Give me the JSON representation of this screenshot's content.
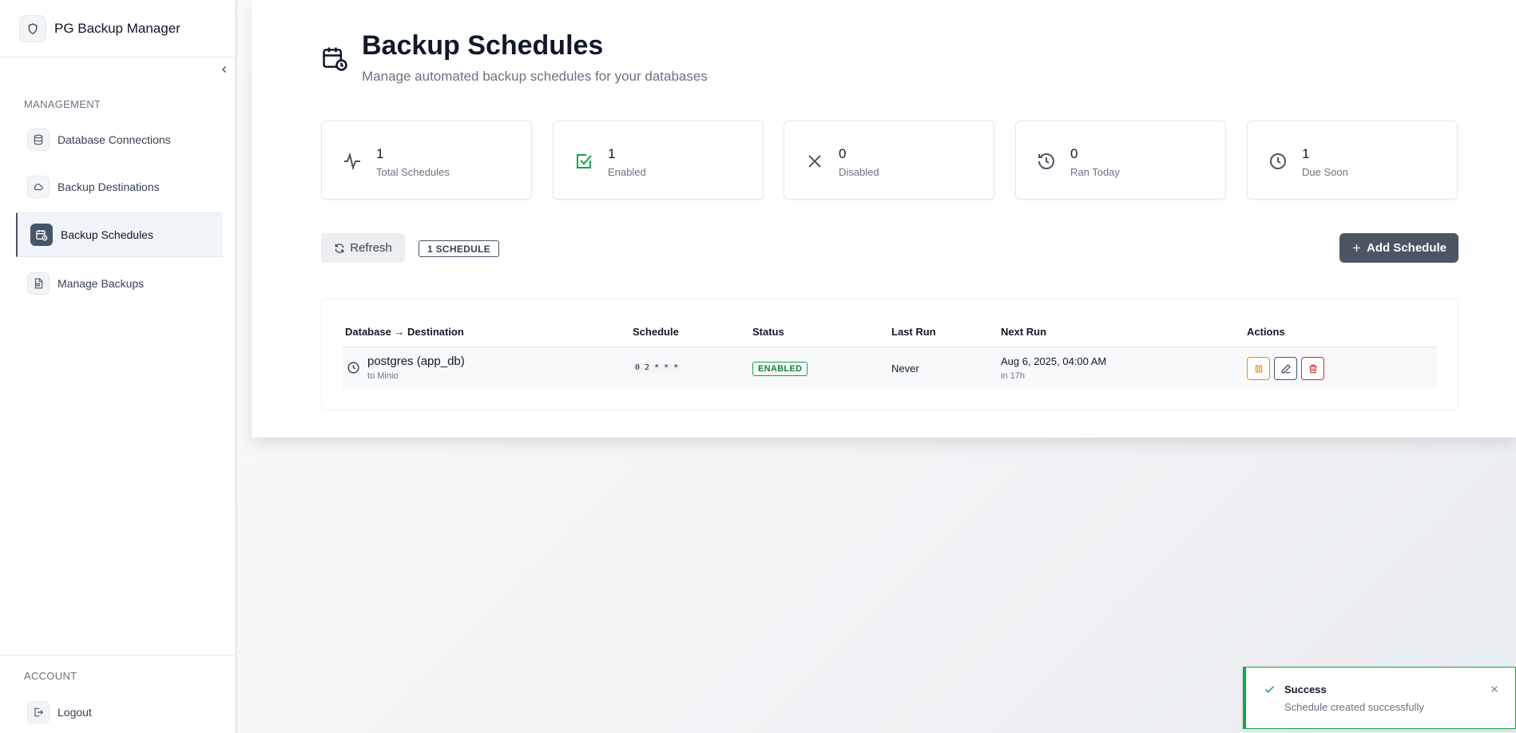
{
  "app": {
    "title": "PG Backup Manager"
  },
  "sidebar": {
    "management_label": "MANAGEMENT",
    "account_label": "ACCOUNT",
    "items": [
      {
        "label": "Database Connections",
        "icon": "database-icon"
      },
      {
        "label": "Backup Destinations",
        "icon": "cloud-icon"
      },
      {
        "label": "Backup Schedules",
        "icon": "calendar-clock-icon",
        "active": true
      },
      {
        "label": "Manage Backups",
        "icon": "file-archive-icon"
      }
    ],
    "logout_label": "Logout"
  },
  "page": {
    "title": "Backup Schedules",
    "subtitle": "Manage automated backup schedules for your databases"
  },
  "stats": [
    {
      "value": "1",
      "label": "Total Schedules",
      "icon": "activity-icon"
    },
    {
      "value": "1",
      "label": "Enabled",
      "icon": "check-square-icon",
      "color": "#16a34a"
    },
    {
      "value": "0",
      "label": "Disabled",
      "icon": "x-icon"
    },
    {
      "value": "0",
      "label": "Ran Today",
      "icon": "history-icon"
    },
    {
      "value": "1",
      "label": "Due Soon",
      "icon": "clock-icon"
    }
  ],
  "toolbar": {
    "refresh_label": "Refresh",
    "count_badge": "1 SCHEDULE",
    "add_label": "Add Schedule"
  },
  "table": {
    "headers": [
      "Database → Destination",
      "Schedule",
      "Status",
      "Last Run",
      "Next Run",
      "Actions"
    ],
    "rows": [
      {
        "database": "postgres (app_db)",
        "destination": "to Minio",
        "schedule": "0 2 * * *",
        "status": "ENABLED",
        "last_run": "Never",
        "next_run": "Aug 6, 2025, 04:00 AM",
        "next_run_relative": "in 17h"
      }
    ]
  },
  "toast": {
    "title": "Success",
    "message": "Schedule created successfully"
  },
  "colors": {
    "accent": "#4b5563",
    "success": "#16a34a",
    "pause": "#ea8a1a",
    "delete": "#dc2626"
  }
}
